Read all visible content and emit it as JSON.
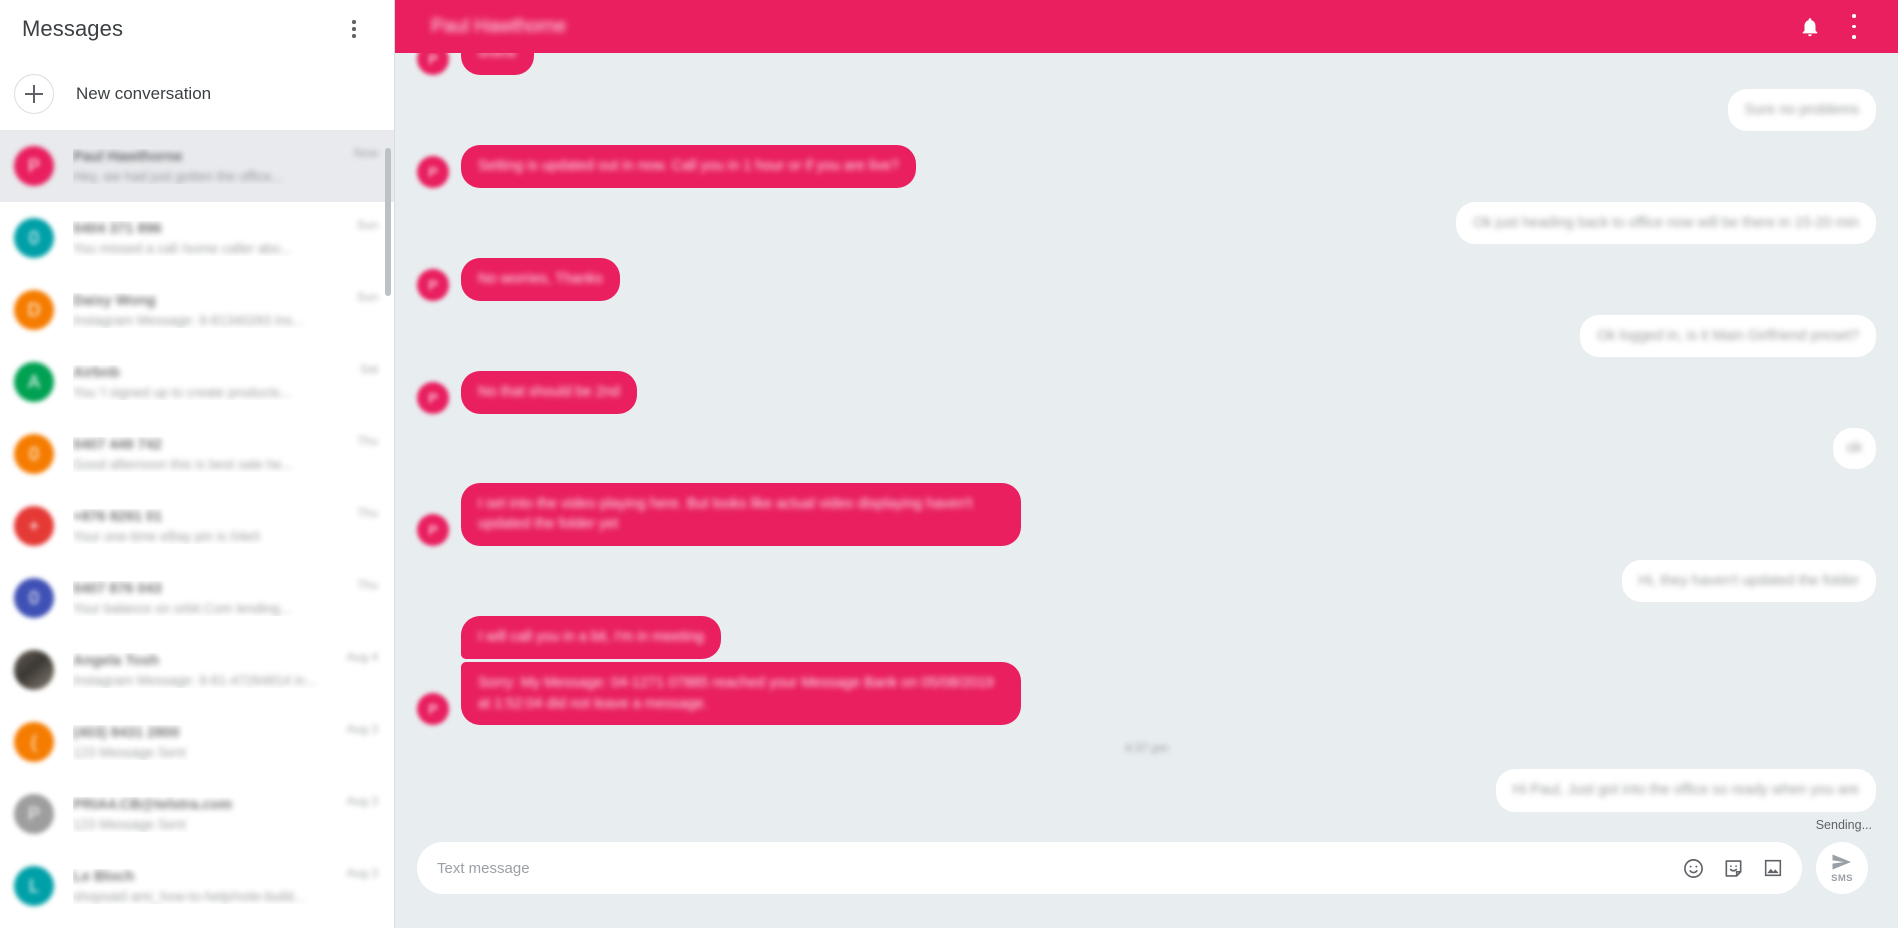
{
  "theme": {
    "accent": "#e91f5f",
    "chat_bg": "#e8edf0",
    "selected_bg": "#e8eaed",
    "sidebar_bg": "#ffffff",
    "text_primary": "#202124",
    "text_secondary": "#5f6368"
  },
  "sidebar": {
    "title": "Messages",
    "overflow_menu_icon": "kebab-menu-icon",
    "new_conversation": {
      "label": "New conversation",
      "icon": "plus-icon"
    },
    "conversations": [
      {
        "name": "Paul Hawthorne",
        "snippet": "Hey, we had just gotten the office...",
        "time": "Now",
        "avatar_color": "#e91f5f",
        "avatar_letter": "P",
        "selected": true
      },
      {
        "name": "0404 371 896",
        "snippet": "You missed a call /some caller abo...",
        "time": "Sun",
        "avatar_color": "#00a0a8",
        "avatar_letter": "0",
        "selected": false
      },
      {
        "name": "Daisy Wong",
        "snippet": "Instagram Message: 9-81340283 ins...",
        "time": "Sun",
        "avatar_color": "#f57c00",
        "avatar_letter": "D",
        "selected": false
      },
      {
        "name": "Airbnb",
        "snippet": "You 'I signed up to create products...",
        "time": "Sat",
        "avatar_color": "#00a152",
        "avatar_letter": "A",
        "selected": false
      },
      {
        "name": "0407 449 742",
        "snippet": "Good afternoon this is best sale he...",
        "time": "Thu",
        "avatar_color": "#f57c00",
        "avatar_letter": "0",
        "selected": false
      },
      {
        "name": "+876 8291 01",
        "snippet": "Your one-time eBay pin is 04e0",
        "time": "Thu",
        "avatar_color": "#e53935",
        "avatar_letter": "+",
        "selected": false
      },
      {
        "name": "0407 876 043",
        "snippet": "Your balance on orbit.Com lending...",
        "time": "Thu",
        "avatar_color": "#3f51b5",
        "avatar_letter": "0",
        "selected": false
      },
      {
        "name": "Angela Tosh",
        "snippet": "Instagram Message: 9-81-47264814 in...",
        "time": "Aug 4",
        "avatar_color": "#6d6258",
        "avatar_letter": "",
        "avatar_photo": true,
        "selected": false
      },
      {
        "name": "(403) 8431 2800",
        "snippet": "123 Message Sent",
        "time": "Aug 3",
        "avatar_color": "#f57c00",
        "avatar_letter": "(",
        "selected": false
      },
      {
        "name": "PRIA4.CB@telstra.com",
        "snippet": "123 Message Sent",
        "time": "Aug 3",
        "avatar_color": "#9e9e9e",
        "avatar_letter": "P",
        "selected": false
      },
      {
        "name": "Le Bloch",
        "snippet": "shopsaid ami_how-to-help/note-build...",
        "time": "Aug 3",
        "avatar_color": "#00a0a8",
        "avatar_letter": "L",
        "selected": false
      }
    ]
  },
  "topbar": {
    "title": "Paul Hawthorne",
    "notifications_icon": "bell-icon",
    "overflow_menu_icon": "kebab-menu-icon"
  },
  "thread": {
    "messages": [
      {
        "id": 1,
        "side": "in",
        "text": "online",
        "avatar_letter": "P",
        "show_avatar": true,
        "clipped": true
      },
      {
        "id": 2,
        "side": "out",
        "text": "Sure no problems"
      },
      {
        "id": 3,
        "side": "in",
        "text": "Setting is updated out in now. Call you in 1 hour or if you are live?",
        "avatar_letter": "P",
        "show_avatar": true
      },
      {
        "id": 4,
        "side": "out",
        "text": "Ok just heading back to office now will be there in 15-20 min"
      },
      {
        "id": 5,
        "side": "in",
        "text": "No worries, Thanks",
        "avatar_letter": "P",
        "show_avatar": true
      },
      {
        "id": 6,
        "side": "out",
        "text": "Ok logged in, is it Main Girlfriend preset?"
      },
      {
        "id": 7,
        "side": "in",
        "text": "No that should be 2nd",
        "avatar_letter": "P",
        "show_avatar": true
      },
      {
        "id": 8,
        "side": "out",
        "text": "ok",
        "tiny": true
      },
      {
        "id": 9,
        "side": "in",
        "text": "I set into the video playing here. But looks like actual video displaying haven't updated the folder yet",
        "avatar_letter": "P",
        "show_avatar": true
      },
      {
        "id": 10,
        "side": "out",
        "text": "Hi, they haven't updated the folder"
      },
      {
        "id": 11,
        "side": "in",
        "text": "I will call you in a bit, I'm in meeting",
        "avatar_letter": "P",
        "show_avatar": false,
        "stack": "top"
      },
      {
        "id": 12,
        "side": "in",
        "text": "Sorry: My Message: 04-1271 07885 reached your Message Bank on 05/08/2019 at 1:52:04 did not leave a message.",
        "avatar_letter": "P",
        "show_avatar": true,
        "stack": "bot"
      }
    ],
    "timestamp": "4:37 pm",
    "pending_message": {
      "side": "out",
      "text": "Hi Paul, Just got into the office so ready when you are"
    },
    "status": "Sending..."
  },
  "composer": {
    "placeholder": "Text message",
    "value": "",
    "emoji_icon": "emoji-smile-icon",
    "sticker_icon": "sticker-icon",
    "image_icon": "image-icon",
    "send": {
      "label": "SMS",
      "icon": "send-arrow-icon"
    }
  }
}
